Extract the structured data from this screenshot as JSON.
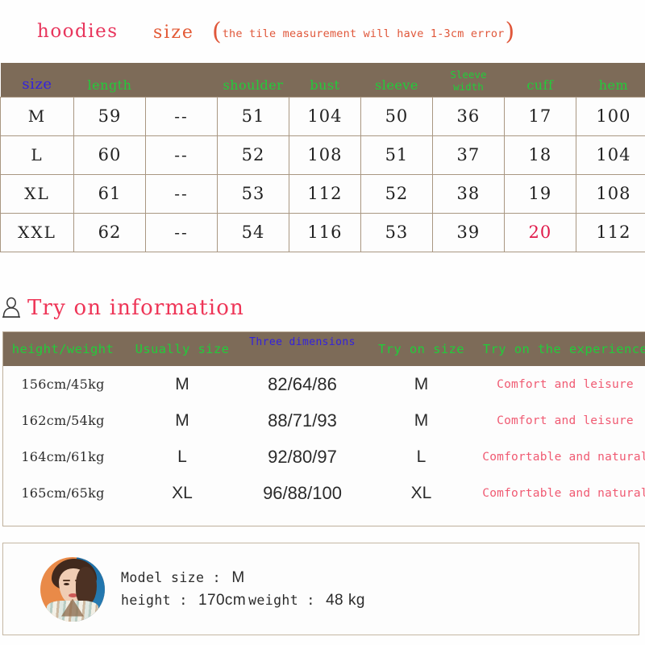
{
  "title": {
    "main": "hoodies",
    "sub": "size",
    "note": "the tile measurement will have 1-3cm error",
    "paren_open": "(",
    "paren_close": ")",
    "color_main": "#e8365d",
    "color_sub": "#e35a36",
    "color_note": "#e0573a"
  },
  "size_table": {
    "header_bg": "#7d6b58",
    "header_text_color": "#22cc3a",
    "header_size_color": "#3322dd",
    "highlight_color": "#e01a4a",
    "columns": [
      "size",
      "length",
      "",
      "shoulder",
      "bust",
      "sleeve",
      "Sleeve width",
      "cuff",
      "hem"
    ],
    "rows": [
      {
        "size": "M",
        "length": "59",
        "blank": "--",
        "shoulder": "51",
        "bust": "104",
        "sleeve": "50",
        "sleeve_width": "36",
        "cuff": "17",
        "hem": "100"
      },
      {
        "size": "L",
        "length": "60",
        "blank": "--",
        "shoulder": "52",
        "bust": "108",
        "sleeve": "51",
        "sleeve_width": "37",
        "cuff": "18",
        "hem": "104"
      },
      {
        "size": "XL",
        "length": "61",
        "blank": "--",
        "shoulder": "53",
        "bust": "112",
        "sleeve": "52",
        "sleeve_width": "38",
        "cuff": "19",
        "hem": "108"
      },
      {
        "size": "XXL",
        "length": "62",
        "blank": "--",
        "shoulder": "54",
        "bust": "116",
        "sleeve": "53",
        "sleeve_width": "39",
        "cuff": "20",
        "hem": "112"
      }
    ]
  },
  "tryon_section": {
    "heading": "Try on information",
    "heading_color": "#ee3557",
    "icon": "person-icon"
  },
  "tryon_table": {
    "header_bg": "#7d6b58",
    "header_text_color": "#22cc3a",
    "header_blue_color": "#3322dd",
    "experience_color": "#f05a72",
    "columns": [
      "height/weight",
      "Usually size",
      "Three dimensions",
      "Try on size",
      "Try on the experience"
    ],
    "rows": [
      {
        "hw": "156cm/45kg",
        "usual": "M",
        "dims": "82/64/86",
        "trysize": "M",
        "experience": "Comfort and leisure"
      },
      {
        "hw": "162cm/54kg",
        "usual": "M",
        "dims": "88/71/93",
        "trysize": "M",
        "experience": "Comfort and leisure"
      },
      {
        "hw": "164cm/61kg",
        "usual": "L",
        "dims": "92/80/97",
        "trysize": "L",
        "experience": "Comfortable and natural"
      },
      {
        "hw": "165cm/65kg",
        "usual": "XL",
        "dims": "96/88/100",
        "trysize": "XL",
        "experience": "Comfortable and natural"
      }
    ]
  },
  "model_card": {
    "avatar": "model-photo",
    "size_label": "Model size",
    "size_sep": " : ",
    "size_value": "M",
    "height_label": "height",
    "height_sep": " : ",
    "height_value": "170cm",
    "weight_label": "weight",
    "weight_sep": " : ",
    "weight_value": "48",
    "weight_unit": "kg"
  }
}
